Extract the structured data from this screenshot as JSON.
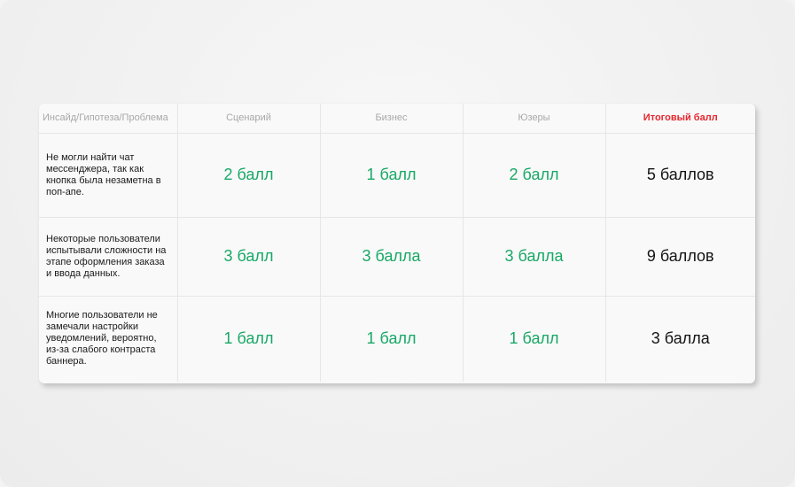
{
  "table": {
    "headers": {
      "insight": "Инсайд/Гипотеза/Проблема",
      "scenario": "Сценарий",
      "business": "Бизнес",
      "users": "Юзеры",
      "total": "Итоговый балл"
    },
    "rows": [
      {
        "description": "Не могли найти чат мессенджера, так как кнопка была незаметна в поп-апе.",
        "scenario": "2 балл",
        "business": "1 балл",
        "users": "2 балл",
        "total": "5 баллов"
      },
      {
        "description": "Некоторые пользователи испытывали сложности на этапе оформления заказа и ввода данных.",
        "scenario": "3 балл",
        "business": "3 балла",
        "users": "3 балла",
        "total": "9 баллов"
      },
      {
        "description": "Многие пользователи не замечали настройки уведомлений, вероятно, из-за слабого контраста баннера.",
        "scenario": "1 балл",
        "business": "1 балл",
        "users": "1 балл",
        "total": "3 балла"
      }
    ]
  },
  "colors": {
    "score_green": "#19a866",
    "total_header_red": "#e8262c",
    "header_gray": "#a8a8a8"
  }
}
